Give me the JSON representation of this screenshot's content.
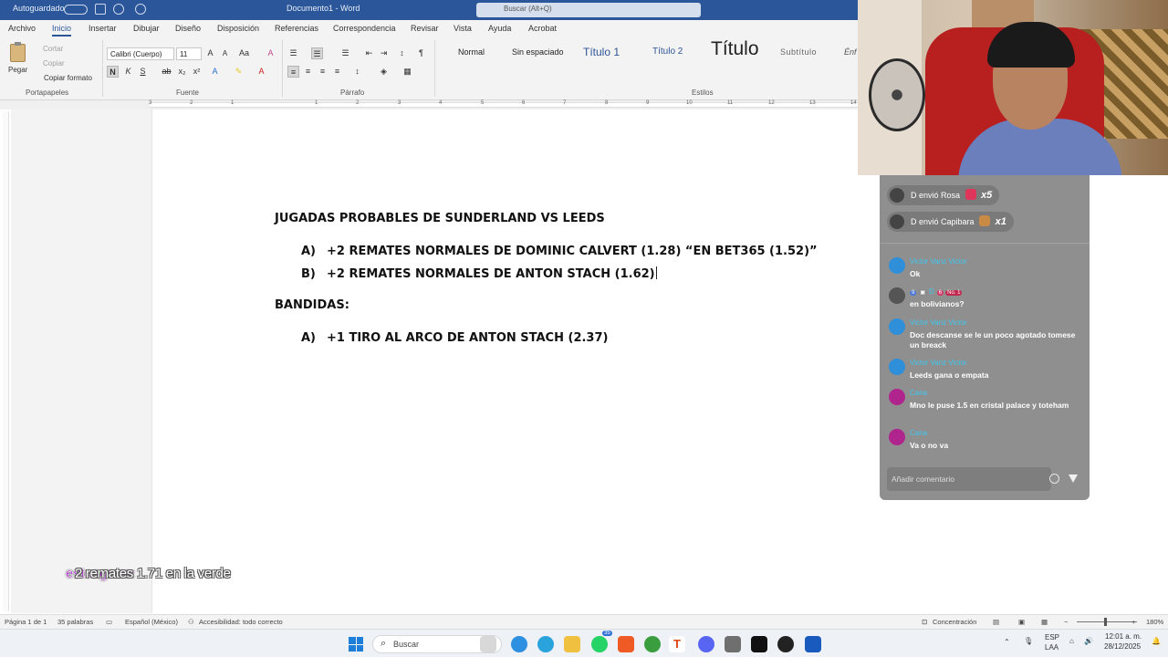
{
  "titlebar": {
    "autosave": "Autoguardado",
    "doc_title": "Documento1 - Word",
    "search": "Buscar (Alt+Q)"
  },
  "ribbon": {
    "tabs": [
      "Archivo",
      "Inicio",
      "Insertar",
      "Dibujar",
      "Diseño",
      "Disposición",
      "Referencias",
      "Correspondencia",
      "Revisar",
      "Vista",
      "Ayuda",
      "Acrobat"
    ],
    "active_tab": "Inicio",
    "clipboard": {
      "paste": "Pegar",
      "cut": "Cortar",
      "copy": "Copiar",
      "format_painter": "Copiar formato",
      "label": "Portapapeles"
    },
    "font": {
      "name": "Calibri (Cuerpo)",
      "size": "11",
      "label": "Fuente"
    },
    "paragraph": {
      "label": "Párrafo"
    },
    "styles": {
      "label": "Estilos",
      "items": [
        "Normal",
        "Sin espaciado",
        "Título 1",
        "Título 2",
        "Título",
        "Subtítulo",
        "Énf"
      ]
    }
  },
  "ruler_numbers": [
    "3",
    "2",
    "1",
    "1",
    "2",
    "3",
    "4",
    "5",
    "6",
    "7",
    "8",
    "9",
    "10",
    "11",
    "12",
    "13",
    "14"
  ],
  "document": {
    "heading1": "JUGADAS PROBABLES DE SUNDERLAND VS LEEDS",
    "list1": [
      {
        "marker": "A)",
        "text": "+2 REMATES NORMALES DE DOMINIC CALVERT (1.28) “EN BET365 (1.52)”"
      },
      {
        "marker": "B)",
        "text": "+2 REMATES NORMALES DE ANTON STACH (1.62)"
      }
    ],
    "heading2": "BANDIDAS:",
    "list2": [
      {
        "marker": "A)",
        "text": "+1 TIRO AL ARCO DE ANTON STACH (2.37)"
      }
    ]
  },
  "overlay_comment": {
    "user": "esteagnus:",
    "message": "2 remates 1.71 en la verde"
  },
  "statusbar": {
    "page": "Página 1 de 1",
    "words": "35 palabras",
    "language": "Español (México)",
    "accessibility": "Accesibilidad: todo correcto",
    "focus": "Concentración",
    "zoom": "180%"
  },
  "taskbar": {
    "search_placeholder": "Buscar",
    "badge": "35",
    "lang_top": "ESP",
    "lang_bottom": "LAA",
    "time": "12:01 a. m.",
    "date": "28/12/2025"
  },
  "chat": {
    "gifts": [
      {
        "text": "D envió Rosa",
        "count": "x5",
        "color": "#e0355a"
      },
      {
        "text": "D envió Capibara",
        "count": "x1",
        "color": "#c98a45"
      }
    ],
    "messages": [
      {
        "name": "Victor Vanz Victor",
        "text": "Ok",
        "avatar_color": "#2f8fd8"
      },
      {
        "name": "D",
        "badges": [
          "9",
          "6",
          "No. 1"
        ],
        "text": "en bolivianos?",
        "avatar_color": "#555555"
      },
      {
        "name": "Victor Vanz Victor",
        "text": "Doc descanse se le un poco agotado tomese un breack",
        "avatar_color": "#2f8fd8"
      },
      {
        "name": "Victor Vanz Victor",
        "text": "Leeds gana o empata",
        "avatar_color": "#2f8fd8"
      },
      {
        "name": "Cana",
        "text": "Mno le puse 1.5 en cristal palace y toteham",
        "avatar_color": "#b0248e"
      },
      {
        "name": "Cana",
        "text": "Va o no va",
        "avatar_color": "#b0248e"
      }
    ],
    "input_placeholder": "Añadir comentario"
  }
}
